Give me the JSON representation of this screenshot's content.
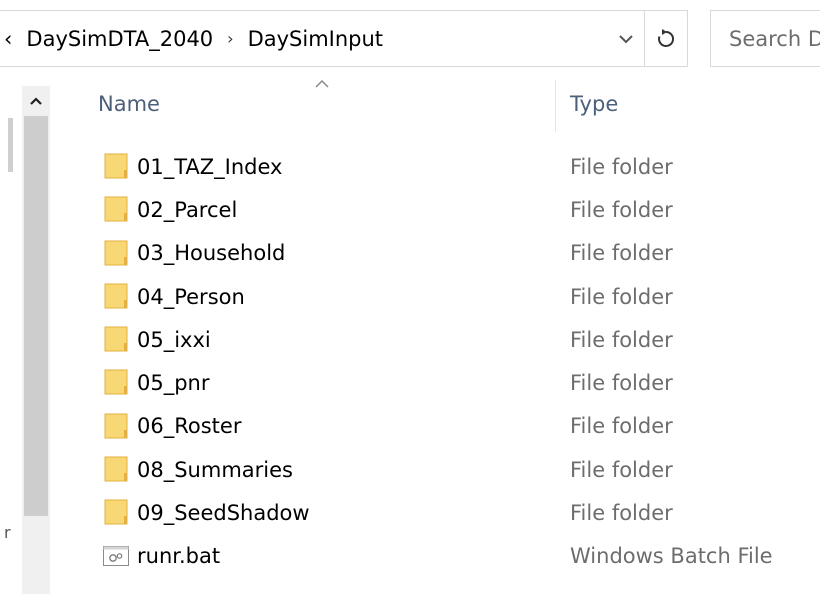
{
  "address_bar": {
    "prefix": "‹",
    "crumbs": [
      "DaySimDTA_2040",
      "DaySimInput"
    ],
    "separator": "›"
  },
  "search": {
    "placeholder": "Search D"
  },
  "columns": {
    "name": "Name",
    "type": "Type"
  },
  "nav_pane": {
    "partial_char": "r"
  },
  "files": [
    {
      "name": "01_TAZ_Index",
      "type": "File folder",
      "icon": "folder-icon"
    },
    {
      "name": "02_Parcel",
      "type": "File folder",
      "icon": "folder-icon"
    },
    {
      "name": "03_Household",
      "type": "File folder",
      "icon": "folder-icon"
    },
    {
      "name": "04_Person",
      "type": "File folder",
      "icon": "folder-icon"
    },
    {
      "name": "05_ixxi",
      "type": "File folder",
      "icon": "folder-icon"
    },
    {
      "name": "05_pnr",
      "type": "File folder",
      "icon": "folder-icon"
    },
    {
      "name": "06_Roster",
      "type": "File folder",
      "icon": "folder-icon"
    },
    {
      "name": "08_Summaries",
      "type": "File folder",
      "icon": "folder-icon"
    },
    {
      "name": "09_SeedShadow",
      "type": "File folder",
      "icon": "folder-icon"
    },
    {
      "name": "runr.bat",
      "type": "Windows Batch File",
      "icon": "batch-file-icon"
    }
  ],
  "colors": {
    "folder_body": "#f8d775",
    "folder_edge": "#e3b041",
    "header_text": "#4c607a",
    "secondary_text": "#6d6d6d",
    "scroll_thumb": "#cdcdcd"
  }
}
